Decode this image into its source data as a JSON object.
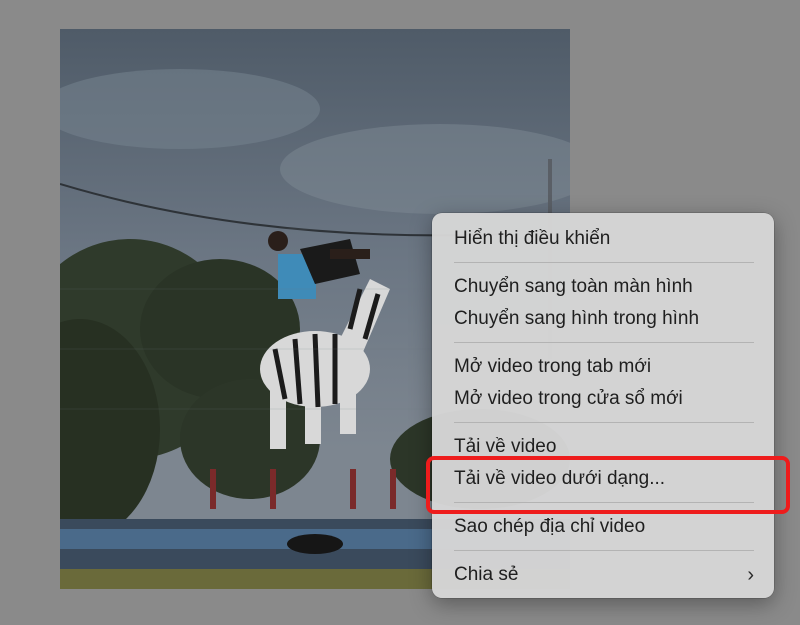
{
  "menu": {
    "show_controls": "Hiển thị điều khiển",
    "fullscreen": "Chuyển sang toàn màn hình",
    "picture_in_picture": "Chuyển sang hình trong hình",
    "open_new_tab": "Mở video trong tab mới",
    "open_new_window": "Mở video trong cửa sổ mới",
    "download": "Tải về video",
    "download_as": "Tải về video dưới dạng...",
    "copy_address": "Sao chép địa chỉ video",
    "share": "Chia sẻ",
    "share_chevron": "›"
  },
  "colors": {
    "highlight": "#ee1c1c",
    "menu_bg": "#d6d6d6",
    "page_bg": "#8a8a8a"
  }
}
